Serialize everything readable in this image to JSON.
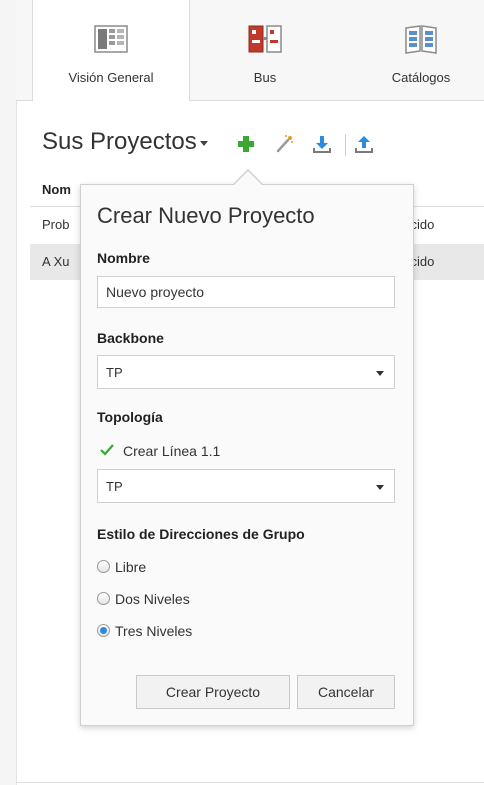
{
  "ribbon": {
    "tabs": [
      {
        "label": "Visión General",
        "icon": "overview-grid-icon",
        "active": true
      },
      {
        "label": "Bus",
        "icon": "bus-devices-icon",
        "active": false
      },
      {
        "label": "Catálogos",
        "icon": "catalog-book-icon",
        "active": false
      }
    ]
  },
  "projects": {
    "title": "Sus Proyectos",
    "toolbar": [
      "add-project-icon",
      "wand-icon",
      "download-icon",
      "upload-icon"
    ],
    "table": {
      "header": "Nom",
      "rows": [
        {
          "name": "Prob",
          "state": "nocido"
        },
        {
          "name": "A Xu",
          "state": "nocido"
        }
      ]
    }
  },
  "dialog": {
    "title": "Crear Nuevo Proyecto",
    "name_label": "Nombre",
    "name_value": "Nuevo proyecto",
    "backbone_label": "Backbone",
    "backbone_value": "TP",
    "topology_label": "Topología",
    "create_line_label": "Crear Línea 1.1",
    "create_line_checked": true,
    "topology_value": "TP",
    "group_style_label": "Estilo de Direcciones de Grupo",
    "options": [
      {
        "label": "Libre",
        "checked": false
      },
      {
        "label": "Dos Niveles",
        "checked": false
      },
      {
        "label": "Tres Niveles",
        "checked": true
      }
    ],
    "create_button": "Crear Proyecto",
    "cancel_button": "Cancelar"
  },
  "colors": {
    "accent_green": "#3aa636",
    "accent_blue": "#2a8be0",
    "icon_red": "#c0392b"
  }
}
